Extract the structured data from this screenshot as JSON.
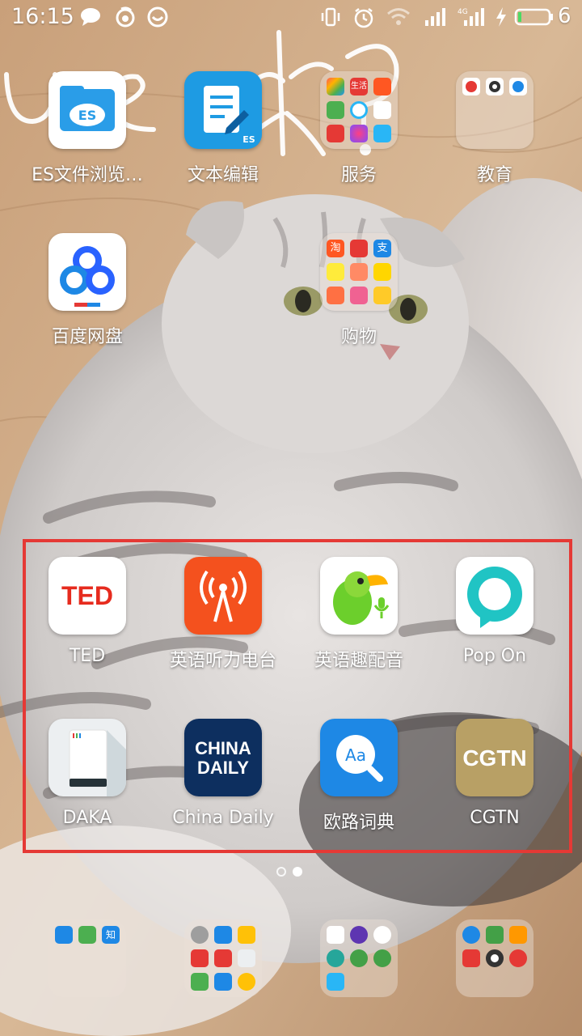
{
  "status_bar": {
    "time": "16:15",
    "battery_level": "6",
    "icons": [
      "chat-icon",
      "weibo-icon",
      "emoji-app-icon",
      "vibrate-icon",
      "alarm-icon",
      "wifi-icon",
      "signal-icon",
      "4g-signal-icon",
      "charging-icon",
      "battery-icon"
    ]
  },
  "apps": [
    {
      "label": "ES文件浏览…",
      "icon": "es-file-explorer-icon"
    },
    {
      "label": "文本编辑",
      "icon": "text-editor-icon"
    },
    {
      "label": "服务",
      "icon": "folder-icon"
    },
    {
      "label": "教育",
      "icon": "folder-icon"
    },
    {
      "label": "百度网盘",
      "icon": "baidu-netdisk-icon"
    },
    {
      "label": "购物",
      "icon": "folder-icon"
    },
    {
      "label": "TED",
      "icon": "ted-icon",
      "icon_text": "TED"
    },
    {
      "label": "英语听力电台",
      "icon": "radio-tower-icon"
    },
    {
      "label": "英语趣配音",
      "icon": "parrot-icon"
    },
    {
      "label": "Pop On",
      "icon": "pop-on-icon"
    },
    {
      "label": "DAKA",
      "icon": "daka-icon"
    },
    {
      "label": "China Daily",
      "icon": "china-daily-icon",
      "icon_text_1": "CHINA",
      "icon_text_2": "DAILY"
    },
    {
      "label": "欧路词典",
      "icon": "eudic-icon",
      "icon_text": "Aa"
    },
    {
      "label": "CGTN",
      "icon": "cgtn-icon",
      "icon_text": "CGTN"
    }
  ],
  "folder_minis": {
    "service_top_text": "生活",
    "education": [],
    "edu_minis": 3,
    "shopping_text_1": "淘",
    "shopping_text_2": "支",
    "dock_1_text": "知"
  },
  "wallpaper_scribble": "ue 米?",
  "page_indicator": {
    "pages": 2,
    "current": 2
  },
  "colors": {
    "highlight": "#e53935",
    "ted_red": "#e62b1e",
    "radio_orange": "#f4511e",
    "cgtn_gold": "#b8a065",
    "china_daily_navy": "#0d2f5f",
    "eudic_blue": "#1e88e5",
    "pop_on_teal": "#20c4c4"
  },
  "dock": [
    {
      "name": "dock-folder-1"
    },
    {
      "name": "dock-folder-2"
    },
    {
      "name": "dock-folder-3"
    },
    {
      "name": "dock-folder-4"
    }
  ]
}
